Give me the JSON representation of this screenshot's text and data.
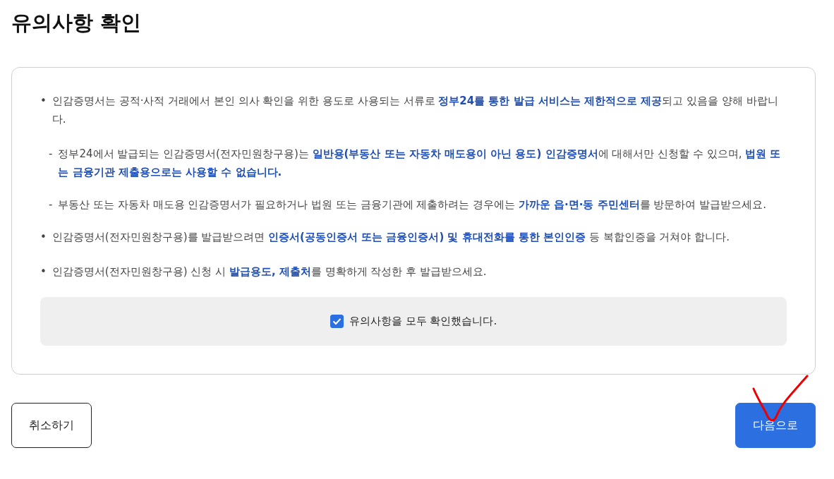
{
  "title": "유의사항 확인",
  "notices": [
    {
      "marker": "•",
      "text": "인감증명서는 공적·사적 거래에서 본인 의사 확인을 위한 용도로 사용되는 서류로 **정부24를 통한 발급 서비스는 제한적으로 제공**되고 있음을 양해 바랍니다.",
      "children": [
        {
          "marker": "-",
          "text": "정부24에서 발급되는 인감증명서(전자민원창구용)는 **일반용(부동산 또는 자동차 매도용이 아닌 용도) 인감증명서**에 대해서만 신청할 수 있으며, **법원 또는 금융기관 제출용으로는 사용할 수 없습니다.**"
        },
        {
          "marker": "-",
          "text": "부동산 또는 자동차 매도용 인감증명서가 필요하거나 법원 또는 금융기관에 제출하려는 경우에는 **가까운 읍·면·동 주민센터**를 방문하여 발급받으세요."
        }
      ]
    },
    {
      "marker": "•",
      "text": "인감증명서(전자민원창구용)를 발급받으려면 **인증서(공동인증서 또는 금융인증서) 및 휴대전화를 통한 본인인증** 등 복합인증을 거쳐야 합니다."
    },
    {
      "marker": "•",
      "text": "인감증명서(전자민원창구용) 신청 시 **발급용도, 제출처**를 명확하게 작성한 후 발급받으세요."
    }
  ],
  "confirm": {
    "label": "유의사항을 모두 확인했습니다.",
    "checked": true
  },
  "buttons": [
    {
      "label": "취소하기",
      "kind": "secondary"
    },
    {
      "label": "다음으로",
      "kind": "primary"
    }
  ]
}
